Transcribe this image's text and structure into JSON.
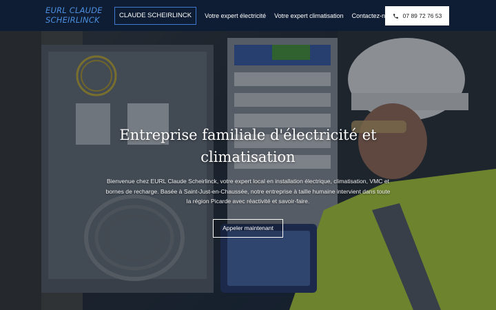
{
  "header": {
    "logo_line1": "EURL CLAUDE",
    "logo_line2": "SCHEIRLINCK",
    "nav": [
      {
        "label": "CLAUDE SCHEIRLINCK",
        "active": true
      },
      {
        "label": "Votre expert électricité"
      },
      {
        "label": "Votre expert climatisation"
      },
      {
        "label": "Contactez-nous"
      }
    ],
    "phone": "07 89 72 76 53",
    "phone_icon": "phone-icon"
  },
  "hero": {
    "title": "Entreprise familiale d'électricité et climatisation",
    "text": "Bienvenue chez EURL Claude Scheirlinck, votre expert local en installation électrique, climatisation, VMC et bornes de recharge. Basée à Saint-Just-en-Chaussée, notre entreprise à taille humaine intervient dans toute la région Picarde avec réactivité et savoir-faire.",
    "cta": "Appeler maintenant"
  },
  "colors": {
    "header_bg": "#0e1d33",
    "accent": "#3d7bd1",
    "logo": "#4c8fe0"
  }
}
